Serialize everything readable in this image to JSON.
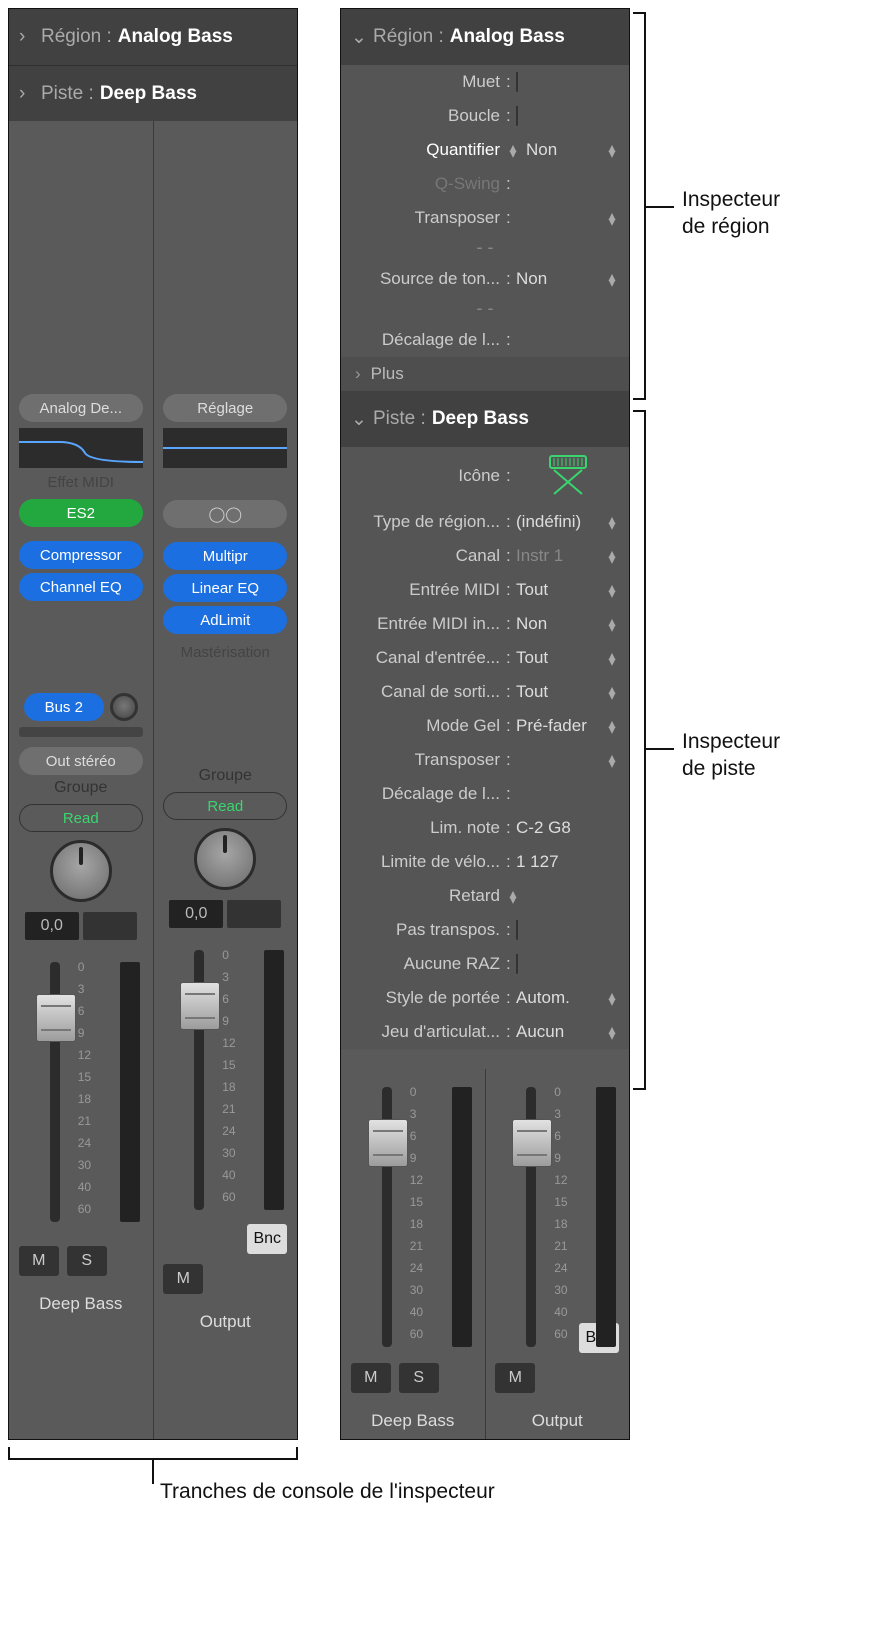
{
  "left": {
    "region_header": {
      "label": "Région :",
      "value": "Analog Bass"
    },
    "track_header": {
      "label": "Piste :",
      "value": "Deep Bass"
    },
    "strip1": {
      "top_pill": "Analog De...",
      "midi_label": "Effet MIDI",
      "instrument": "ES2",
      "fx": [
        "Compressor",
        "Channel EQ"
      ],
      "bus": "Bus 2",
      "output": "Out stéréo",
      "group": "Groupe",
      "automation": "Read",
      "gain": "0,0",
      "mute": "M",
      "solo": "S",
      "name": "Deep Bass"
    },
    "strip2": {
      "top_pill": "Réglage",
      "fx": [
        "Multipr",
        "Linear EQ",
        "AdLimit"
      ],
      "master_label": "Mastérisation",
      "group": "Groupe",
      "automation": "Read",
      "gain": "0,0",
      "bnc": "Bnc",
      "mute": "M",
      "name": "Output"
    }
  },
  "right": {
    "region_header": {
      "label": "Région :",
      "value": "Analog Bass"
    },
    "track_header": {
      "label": "Piste :",
      "value": "Deep Bass"
    },
    "region_params": {
      "mute": "Muet",
      "loop": "Boucle",
      "quantize_k": "Quantifier",
      "quantize_v": "Non",
      "qswing": "Q-Swing",
      "transpose": "Transposer",
      "ksource_k": "Source de ton...",
      "ksource_v": "Non",
      "delay": "Décalage de l...",
      "more": "Plus"
    },
    "track_params": {
      "icon_label": "Icône",
      "region_type_k": "Type de région...",
      "region_type_v": "(indéfini)",
      "channel_k": "Canal",
      "channel_v": "Instr 1",
      "midi_in_k": "Entrée MIDI",
      "midi_in_v": "Tout",
      "midi_in_in_k": "Entrée MIDI in...",
      "midi_in_in_v": "Non",
      "chan_in_k": "Canal d'entrée...",
      "chan_in_v": "Tout",
      "chan_out_k": "Canal de sorti...",
      "chan_out_v": "Tout",
      "freeze_k": "Mode Gel",
      "freeze_v": "Pré-fader",
      "transpose": "Transposer",
      "delay": "Décalage de l...",
      "note_lim_k": "Lim. note",
      "note_lim_v": "C-2  G8",
      "vel_lim_k": "Limite de vélo...",
      "vel_lim_v": "1  127",
      "delay_compact": "Retard",
      "no_transpose": "Pas transpos.",
      "no_reset": "Aucune RAZ",
      "staff_k": "Style de portée",
      "staff_v": "Autom.",
      "artic_k": "Jeu d'articulat...",
      "artic_v": "Aucun"
    },
    "strip1": {
      "mute": "M",
      "solo": "S",
      "name": "Deep Bass"
    },
    "strip2": {
      "bnc": "Bnc",
      "mute": "M",
      "name": "Output"
    }
  },
  "fader_ticks": [
    "0",
    "3",
    "6",
    "9",
    "12",
    "15",
    "18",
    "21",
    "24",
    "30",
    "40",
    "60"
  ],
  "callouts": {
    "region": "Inspecteur\nde région",
    "track": "Inspecteur\nde piste",
    "channels": "Tranches de console de l'inspecteur"
  },
  "icons": {
    "stereo": "⦾"
  }
}
